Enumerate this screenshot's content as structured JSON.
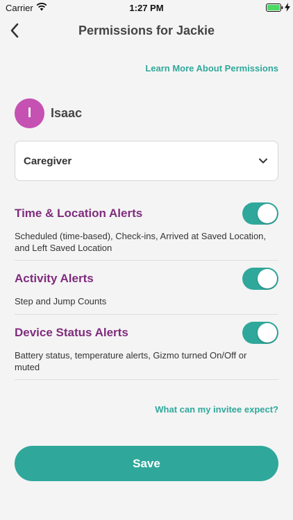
{
  "status_bar": {
    "carrier": "Carrier",
    "time": "1:27 PM"
  },
  "nav": {
    "title": "Permissions for Jackie",
    "back_icon": "chevron-left-icon"
  },
  "links": {
    "learn_more": "Learn More About Permissions",
    "invitee_expect": "What can my invitee expect?"
  },
  "user": {
    "initial": "I",
    "name": "Isaac",
    "avatar_color": "#c551b3"
  },
  "role_select": {
    "value": "Caregiver"
  },
  "permissions": [
    {
      "title": "Time & Location Alerts",
      "description": "Scheduled (time-based), Check-ins, Arrived at Saved Location, and Left Saved Location",
      "enabled": true
    },
    {
      "title": "Activity Alerts",
      "description": "Step and Jump Counts",
      "enabled": true
    },
    {
      "title": "Device Status Alerts",
      "description": "Battery status, temperature alerts, Gizmo turned On/Off or muted",
      "enabled": true
    }
  ],
  "save_label": "Save",
  "colors": {
    "accent": "#2fa89b",
    "title_purple": "#7f2c7c",
    "background": "#f4f4f4"
  }
}
